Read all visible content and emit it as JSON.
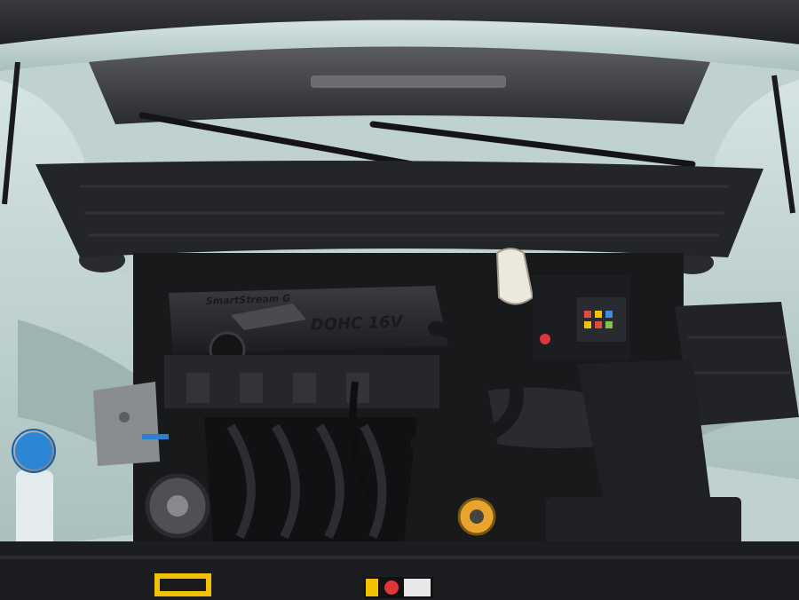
{
  "engine_cover": {
    "brand_text": "SmartStream G",
    "spec_text": "DOHC 16V"
  },
  "colors": {
    "body_paint": "#b7cdcb",
    "body_shadow": "#7d9593",
    "plastic_dark": "#1e1f22",
    "plastic_mid": "#2c2d31",
    "washer_cap": "#2b86d6",
    "warning_label": "#f2c200"
  },
  "icons": {
    "battery": "battery-icon",
    "radiator_cap": "radiator-cap-icon",
    "washer_cap": "washer-fluid-cap-icon",
    "coolant_reservoir": "coolant-reservoir-icon"
  }
}
